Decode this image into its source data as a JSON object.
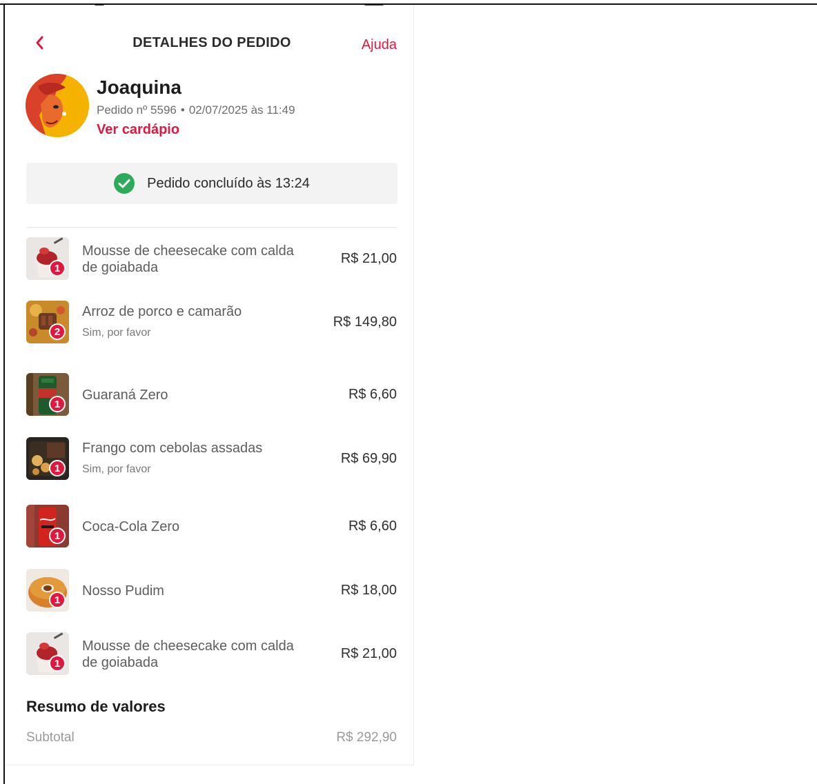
{
  "header": {
    "title": "DETALHES DO PEDIDO",
    "help_label": "Ajuda"
  },
  "store": {
    "name": "Joaquina",
    "order_number": "Pedido nº 5596",
    "separator": "•",
    "order_datetime": "02/07/2025 às 11:49",
    "menu_link": "Ver cardápio"
  },
  "status": {
    "text": "Pedido concluído às 13:24"
  },
  "items": [
    {
      "name": "Mousse de cheesecake com calda de goiabada",
      "note": "",
      "price": "R$ 21,00",
      "qty": "1",
      "image": "cheesecake-mousse"
    },
    {
      "name": "Arroz de porco e camarão",
      "note": "Sim, por favor",
      "price": "R$ 149,80",
      "qty": "2",
      "image": "pork-shrimp-rice"
    },
    {
      "name": "Guaraná Zero",
      "note": "",
      "price": "R$ 6,60",
      "qty": "1",
      "image": "guarana-can"
    },
    {
      "name": "Frango com cebolas assadas",
      "note": "Sim, por favor",
      "price": "R$ 69,90",
      "qty": "1",
      "image": "chicken-onions"
    },
    {
      "name": "Coca-Cola Zero",
      "note": "",
      "price": "R$ 6,60",
      "qty": "1",
      "image": "coca-cola-can"
    },
    {
      "name": "Nosso Pudim",
      "note": "",
      "price": "R$ 18,00",
      "qty": "1",
      "image": "pudding"
    },
    {
      "name": "Mousse de cheesecake com calda de goiabada",
      "note": "",
      "price": "R$ 21,00",
      "qty": "1",
      "image": "cheesecake-mousse"
    }
  ],
  "summary": {
    "title": "Resumo de valores",
    "subtotal_label": "Subtotal",
    "subtotal_value": "R$ 292,90"
  },
  "colors": {
    "accent": "#e1173f",
    "success": "#2eaa5c",
    "status_bg": "#f3f3f3"
  }
}
